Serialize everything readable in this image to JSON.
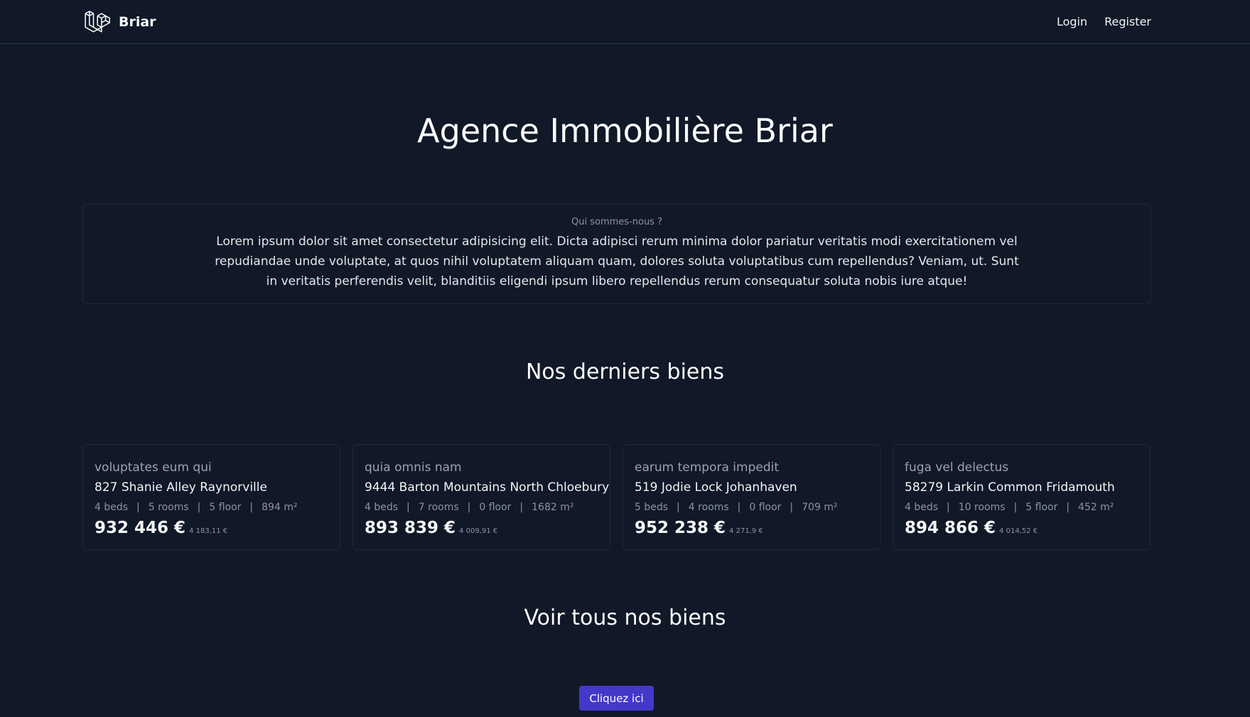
{
  "nav": {
    "brand": "Briar",
    "links": [
      {
        "label": "Login"
      },
      {
        "label": "Register"
      }
    ]
  },
  "hero": {
    "title": "Agence Immobilière Briar"
  },
  "about": {
    "label": "Qui sommes-nous ?",
    "text": "Lorem ipsum dolor sit amet consectetur adipisicing elit. Dicta adipisci rerum minima dolor pariatur veritatis modi exercitationem vel repudiandae unde voluptate, at quos nihil voluptatem aliquam quam, dolores soluta voluptatibus cum repellendus? Veniam, ut. Sunt in veritatis perferendis velit, blanditiis eligendi ipsum libero repellendus rerum consequatur soluta nobis iure atque!"
  },
  "latest": {
    "title": "Nos derniers biens",
    "cards": [
      {
        "title": "voluptates eum qui",
        "address": "827 Shanie Alley Raynorville",
        "beds": "4 beds",
        "rooms": "5 rooms",
        "floor": "5 floor",
        "area": "894 m²",
        "price": "932 446 €",
        "sqm": "4 183,11 €"
      },
      {
        "title": "quia omnis nam",
        "address": "9444 Barton Mountains North Chloebury",
        "beds": "4 beds",
        "rooms": "7 rooms",
        "floor": "0 floor",
        "area": "1682 m²",
        "price": "893 839 €",
        "sqm": "4 009,91 €"
      },
      {
        "title": "earum tempora impedit",
        "address": "519 Jodie Lock Johanhaven",
        "beds": "5 beds",
        "rooms": "4 rooms",
        "floor": "0 floor",
        "area": "709 m²",
        "price": "952 238 €",
        "sqm": "4 271,9 €"
      },
      {
        "title": "fuga vel delectus",
        "address": "58279 Larkin Common Fridamouth",
        "beds": "4 beds",
        "rooms": "10 rooms",
        "floor": "5 floor",
        "area": "452 m²",
        "price": "894 866 €",
        "sqm": "4 014,52 €"
      }
    ]
  },
  "all": {
    "title": "Voir tous nos biens",
    "button": "Cliquez ici"
  },
  "colors": {
    "background": "#111827",
    "accent": "#4338ca"
  }
}
